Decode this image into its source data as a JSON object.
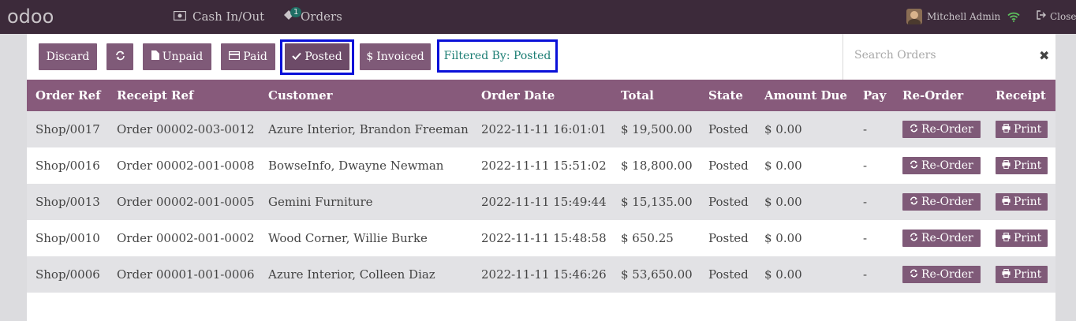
{
  "navbar": {
    "logo": "odoo",
    "cash_label": "Cash In/Out",
    "orders_label": "Orders",
    "orders_badge": "1",
    "user_name": "Mitchell Admin",
    "close_label": "Close"
  },
  "controls": {
    "discard": "Discard",
    "unpaid": "Unpaid",
    "paid": "Paid",
    "posted": "Posted",
    "invoiced": "Invoiced",
    "filter_text": "Filtered By: Posted"
  },
  "search": {
    "placeholder": "Search Orders"
  },
  "table": {
    "headers": [
      "Order Ref",
      "Receipt Ref",
      "Customer",
      "Order Date",
      "Total",
      "State",
      "Amount Due",
      "Pay",
      "Re-Order",
      "Receipt"
    ],
    "reorder_label": "Re-Order",
    "print_label": "Print",
    "rows": [
      {
        "order_ref": "Shop/0017",
        "receipt_ref": "Order 00002-003-0012",
        "customer": "Azure Interior, Brandon Freeman",
        "date": "2022-11-11 16:01:01",
        "total": "$ 19,500.00",
        "state": "Posted",
        "amount_due": "$ 0.00",
        "pay": "-"
      },
      {
        "order_ref": "Shop/0016",
        "receipt_ref": "Order 00002-001-0008",
        "customer": "BowseInfo, Dwayne Newman",
        "date": "2022-11-11 15:51:02",
        "total": "$ 18,800.00",
        "state": "Posted",
        "amount_due": "$ 0.00",
        "pay": "-"
      },
      {
        "order_ref": "Shop/0013",
        "receipt_ref": "Order 00002-001-0005",
        "customer": "Gemini Furniture",
        "date": "2022-11-11 15:49:44",
        "total": "$ 15,135.00",
        "state": "Posted",
        "amount_due": "$ 0.00",
        "pay": "-"
      },
      {
        "order_ref": "Shop/0010",
        "receipt_ref": "Order 00002-001-0002",
        "customer": "Wood Corner, Willie Burke",
        "date": "2022-11-11 15:48:58",
        "total": "$ 650.25",
        "state": "Posted",
        "amount_due": "$ 0.00",
        "pay": "-"
      },
      {
        "order_ref": "Shop/0006",
        "receipt_ref": "Order 00001-001-0006",
        "customer": "Azure Interior, Colleen Diaz",
        "date": "2022-11-11 15:46:26",
        "total": "$ 53,650.00",
        "state": "Posted",
        "amount_due": "$ 0.00",
        "pay": "-"
      }
    ]
  },
  "colors": {
    "navbar": "#3c2a3a",
    "primary": "#875a7b",
    "button": "#7f5a78",
    "highlight_border": "#0a10d8",
    "filter_text": "#1b7d73",
    "wifi_icon": "#5ec35e"
  }
}
